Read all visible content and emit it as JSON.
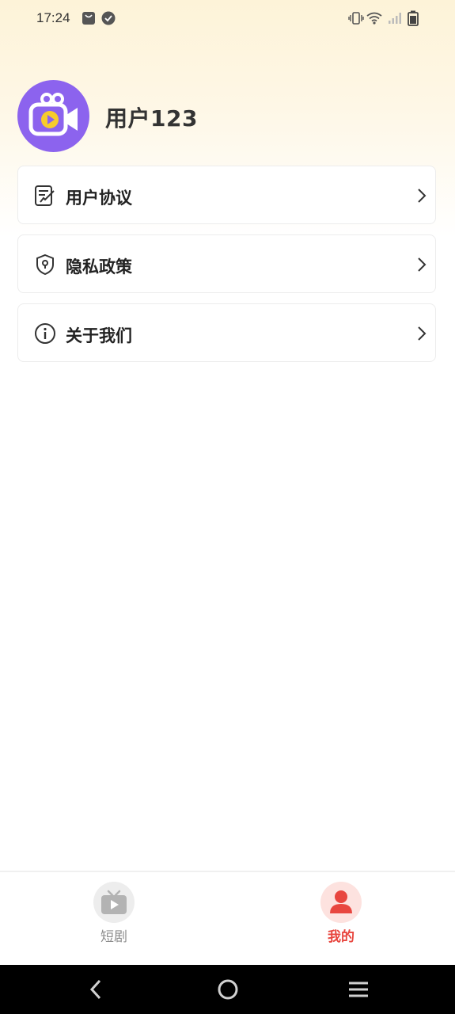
{
  "status_bar": {
    "time": "17:24",
    "icons": [
      "bag-notification-icon",
      "check-circle-icon",
      "vibrate-icon",
      "wifi-icon",
      "signal-icon",
      "battery-icon"
    ]
  },
  "profile": {
    "username": "用户123",
    "avatar_icon": "video-camera-icon",
    "avatar_color": "#8c63ee"
  },
  "menu": {
    "items": [
      {
        "label": "用户协议",
        "icon": "document-edit-icon"
      },
      {
        "label": "隐私政策",
        "icon": "shield-icon"
      },
      {
        "label": "关于我们",
        "icon": "info-icon"
      }
    ]
  },
  "tabs": [
    {
      "label": "短剧",
      "icon": "tv-play-icon",
      "active": false
    },
    {
      "label": "我的",
      "icon": "person-icon",
      "active": true
    }
  ],
  "colors": {
    "accent": "#e8463f",
    "inactive": "#8c8c8c",
    "header_bg": "#fdf3d8"
  },
  "nav_bar": {
    "buttons": [
      "back-icon",
      "home-icon",
      "menu-icon"
    ]
  }
}
